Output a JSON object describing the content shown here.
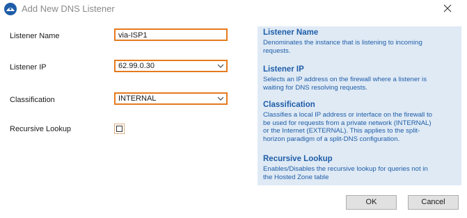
{
  "window": {
    "title": "Add New DNS Listener",
    "app_icon": "app-logo-icon",
    "close_icon": "close-icon"
  },
  "form": {
    "listener_name_label": "Listener Name",
    "listener_name_value": "via-ISP1",
    "listener_ip_label": "Listener IP",
    "listener_ip_value": "62.99.0.30",
    "classification_label": "Classification",
    "classification_value": "INTERNAL",
    "recursive_lookup_label": "Recursive Lookup",
    "recursive_lookup_checked": false
  },
  "help": {
    "listener_name_title": "Listener Name",
    "listener_name_body_1": "Denominates the instance that is listening to incoming",
    "listener_name_body_2": "requests.",
    "listener_ip_title": "Listener IP",
    "listener_ip_body_1": "Selects an IP address on the firewall where a listener is",
    "listener_ip_body_2": "waiting for DNS resolving requests.",
    "classification_title": "Classification",
    "classification_body_1": "Classifies a local IP address or interface on the firewall to",
    "classification_body_2": "be used for requests from a private network (INTERNAL)",
    "classification_body_3": "or the Internet (EXTERNAL). This applies to the split-",
    "classification_body_4": "horizon paradigm of a split-DNS configuration.",
    "recursive_lookup_title": "Recursive Lookup",
    "recursive_lookup_body_1": "Enables/Disables the recursive lookup for queries not in",
    "recursive_lookup_body_2": "the Hosted Zone table"
  },
  "buttons": {
    "ok": "OK",
    "cancel": "Cancel"
  },
  "colors": {
    "accent_border": "#e47a1e",
    "help_background": "#dfeaf5",
    "help_text": "#1f5da8"
  }
}
